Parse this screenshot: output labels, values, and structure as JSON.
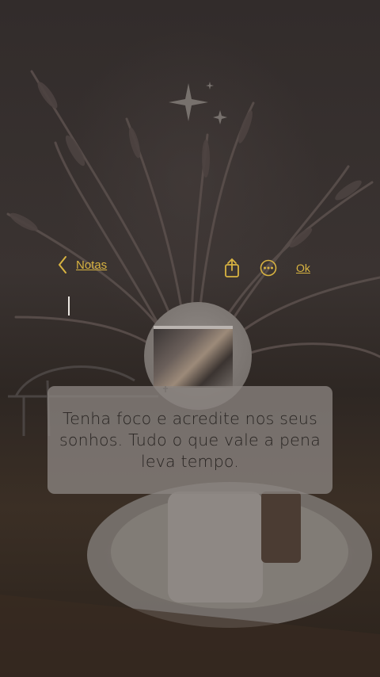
{
  "nav": {
    "back_label": "Notas",
    "done_label": "Ok",
    "back_icon": "chevron-left-icon",
    "share_icon": "share-icon",
    "more_icon": "more-icon"
  },
  "note": {
    "quote": "Tenha foco e acredite nos seus sonhos. Tudo o que vale a pena leva tempo."
  },
  "colors": {
    "accent": "#d8b341",
    "overlay_box": "#8a8480"
  }
}
